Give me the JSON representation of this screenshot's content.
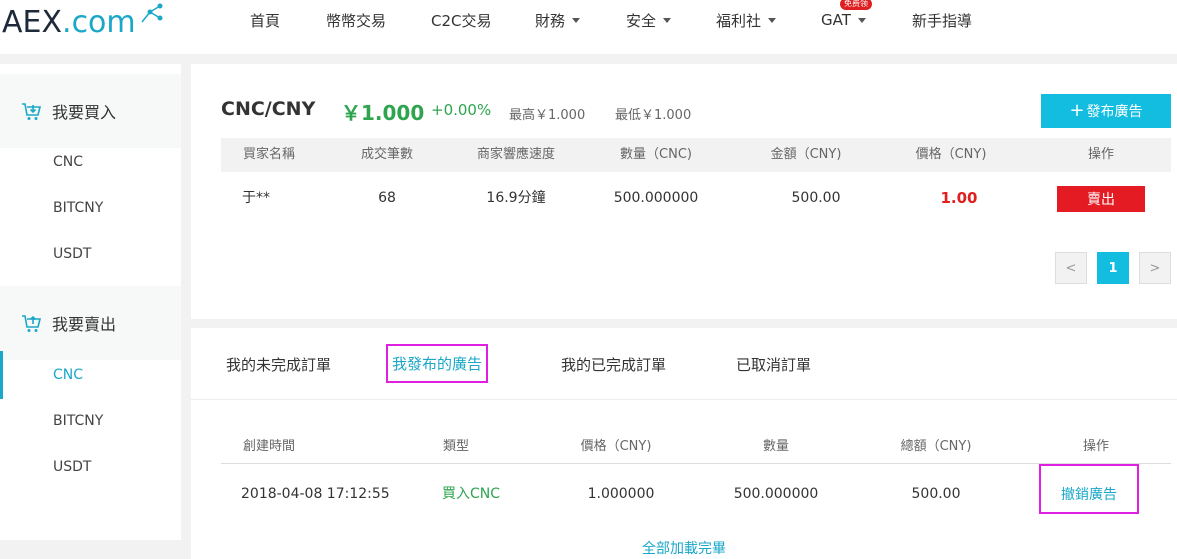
{
  "logo": {
    "brand": "AEX",
    "suffix": ".com"
  },
  "nav": {
    "items": [
      {
        "label": "首頁",
        "dropdown": false
      },
      {
        "label": "幣幣交易",
        "dropdown": false
      },
      {
        "label": "C2C交易",
        "dropdown": false
      },
      {
        "label": "財務",
        "dropdown": true
      },
      {
        "label": "安全",
        "dropdown": true
      },
      {
        "label": "福利社",
        "dropdown": true
      },
      {
        "label": "GAT",
        "dropdown": true,
        "badge": "免费领"
      },
      {
        "label": "新手指導",
        "dropdown": false
      }
    ]
  },
  "sidebar": {
    "buy_title": "我要買入",
    "buy_items": [
      "CNC",
      "BITCNY",
      "USDT"
    ],
    "sell_title": "我要賣出",
    "sell_items": [
      "CNC",
      "BITCNY",
      "USDT"
    ],
    "active": "sell:CNC"
  },
  "market": {
    "pair": "CNC/CNY",
    "price": "￥1.000",
    "change": "+0.00%",
    "high": "最高￥1.000",
    "low": "最低￥1.000",
    "publish_label": "發布廣告"
  },
  "buyers_table": {
    "headers": [
      "買家名稱",
      "成交筆數",
      "商家響應速度",
      "數量（CNC)",
      "金額（CNY)",
      "價格（CNY)",
      "操作"
    ],
    "rows": [
      {
        "name": "于**",
        "trades": "68",
        "speed": "16.9分鐘",
        "amount": "500.000000",
        "total": "500.00",
        "price": "1.00",
        "action": "賣出"
      }
    ]
  },
  "pagination": {
    "prev": "<",
    "current": "1",
    "next": ">"
  },
  "orders": {
    "tabs": [
      "我的未完成訂單",
      "我發布的廣告",
      "我的已完成訂單",
      "已取消訂單"
    ],
    "active_tab": 1,
    "headers": [
      "創建時間",
      "類型",
      "價格（CNY)",
      "數量",
      "總額（CNY)",
      "操作"
    ],
    "rows": [
      {
        "time": "2018-04-08 17:12:55",
        "type": "買入CNC",
        "price": "1.000000",
        "amount": "500.000000",
        "total": "500.00",
        "action": "撤銷廣告"
      }
    ],
    "footer": "全部加載完畢"
  },
  "colors": {
    "accent": "#12bde0",
    "green": "#2ea44f",
    "red": "#e41b23",
    "highlight": "#e020e0"
  }
}
